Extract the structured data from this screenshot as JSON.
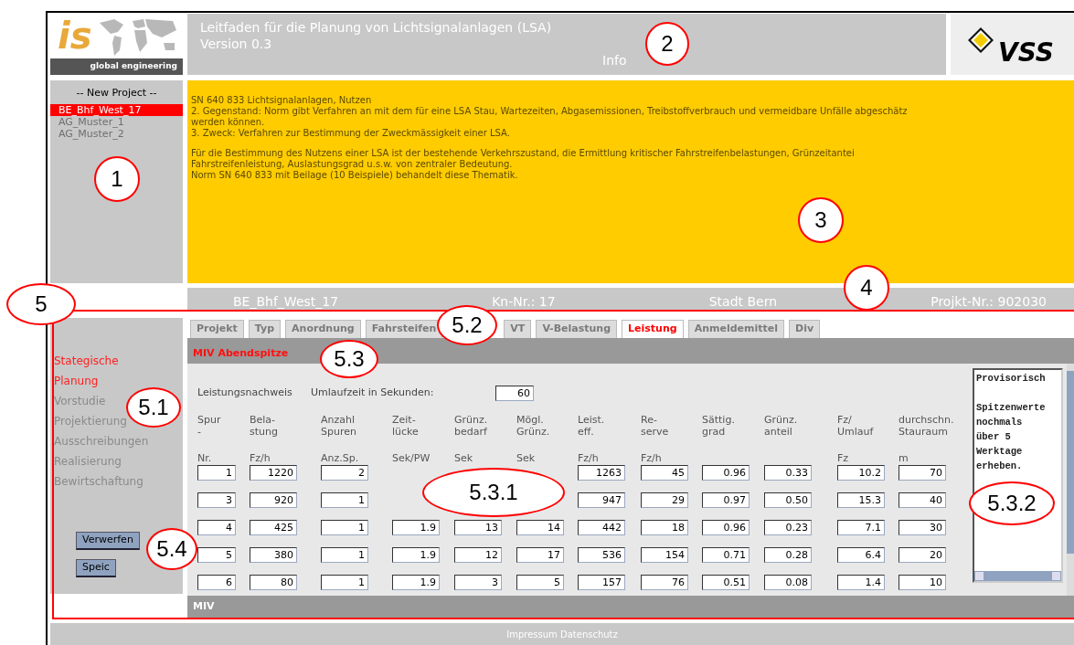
{
  "header": {
    "logo": {
      "mark": "is",
      "tagline": "global engineering"
    },
    "title": "Leitfaden für die Planung von Lichtsignalanlagen (LSA)",
    "version": "Version 0.3",
    "section": "Info",
    "partner_logo": "VSS"
  },
  "projects": {
    "heading": "-- New Project --",
    "items": [
      {
        "label": "BE_Bhf_West_17",
        "selected": true
      },
      {
        "label": "AG_Muster_1",
        "selected": false
      },
      {
        "label": "AG_Muster_2",
        "selected": false
      }
    ]
  },
  "info": {
    "paragraphs": [
      [
        "SN 640 833 Lichtsignalanlagen, Nutzen",
        "2. Gegenstand: Norm gibt Verfahren an mit dem für eine LSA Stau, Wartezeiten, Abgasemissionen, Treibstoffverbrauch und vermeidbare Unfälle abgeschätz",
        "werden können.",
        "3. Zweck: Verfahren zur Bestimmung der Zweckmässigkeit einer LSA."
      ],
      [
        "Für die Bestimmung des Nutzens einer LSA ist der bestehende Verkehrszustand, die Ermittlung kritischer Fahrstreifenbelastungen, Grünzeitantei",
        "Fahrstreifenleistung, Auslastungsgrad u.s.w. von zentraler Bedeutung.",
        "Norm SN 640 833 mit Beilage (10 Beispiele) behandelt diese Thematik."
      ]
    ]
  },
  "project_bar": [
    "BE_Bhf_West_17",
    "Kn-Nr.: 17",
    "Stadt Bern",
    "Projkt-Nr.: 902030"
  ],
  "phases": [
    {
      "label": "Stategische Planung",
      "selected": true
    },
    {
      "label": "Vorstudie",
      "selected": false
    },
    {
      "label": "Projektierung",
      "selected": false
    },
    {
      "label": "Ausschreibungen",
      "selected": false
    },
    {
      "label": "Realisierung",
      "selected": false
    },
    {
      "label": "Bewirtschaftung",
      "selected": false
    }
  ],
  "buttons": [
    "Verwerfen",
    "Speic"
  ],
  "tabs": [
    {
      "label": "Projekt",
      "selected": false
    },
    {
      "label": "Typ",
      "selected": false
    },
    {
      "label": "Anordnung",
      "selected": false
    },
    {
      "label": "Fahrsteifen",
      "selected": false
    },
    {
      "label": "VT",
      "selected": false
    },
    {
      "label": "V-Belastung",
      "selected": false
    },
    {
      "label": "Leistung",
      "selected": true
    },
    {
      "label": "Anmeldemittel",
      "selected": false
    },
    {
      "label": "Div",
      "selected": false
    }
  ],
  "panel": {
    "title": "MIV Abendspitze",
    "footer": "MIV",
    "heading": "Leistungsnachweis",
    "cycle_label": "Umlaufzeit in Sekunden:",
    "cycle_value": "60",
    "columns": [
      {
        "header": [
          "Spur",
          "-"
        ],
        "unit": "Nr."
      },
      {
        "header": [
          "Bela-",
          "stung"
        ],
        "unit": "Fz/h"
      },
      {
        "header": [
          "Anzahl",
          "Spuren"
        ],
        "unit": "Anz.Sp."
      },
      {
        "header": [
          "Zeit-",
          "lücke"
        ],
        "unit": "Sek/PW"
      },
      {
        "header": [
          "Grünz.",
          "bedarf"
        ],
        "unit": "Sek"
      },
      {
        "header": [
          "Mögl.",
          "Grünz."
        ],
        "unit": "Sek"
      },
      {
        "header": [
          "Leist.",
          "eff."
        ],
        "unit": "Fz/h"
      },
      {
        "header": [
          "Re-",
          "serve"
        ],
        "unit": "Fz/h"
      },
      {
        "header": [
          "Sättig.",
          "grad"
        ]
      },
      {
        "header": [
          "Grünz.",
          "anteil"
        ]
      },
      {
        "header": [
          "Fz/",
          "Umlauf"
        ],
        "unit": "Fz"
      },
      {
        "header": [
          "durchschn.",
          "Stauraum"
        ],
        "unit": "m"
      }
    ],
    "rows": [
      [
        "1",
        "1220",
        "2",
        null,
        null,
        null,
        "1263",
        "45",
        "0.96",
        "0.33",
        "10.2",
        "70"
      ],
      [
        "3",
        "920",
        "1",
        null,
        null,
        null,
        "947",
        "29",
        "0.97",
        "0.50",
        "15.3",
        "40"
      ],
      [
        "4",
        "425",
        "1",
        "1.9",
        "13",
        "14",
        "442",
        "18",
        "0.96",
        "0.23",
        "7.1",
        "30"
      ],
      [
        "5",
        "380",
        "1",
        "1.9",
        "12",
        "17",
        "536",
        "154",
        "0.71",
        "0.28",
        "6.4",
        "20"
      ],
      [
        "6",
        "80",
        "1",
        "1.9",
        "3",
        "5",
        "157",
        "76",
        "0.51",
        "0.08",
        "1.4",
        "10"
      ]
    ],
    "notes": [
      [
        "Provisorisch"
      ],
      [
        "Spitzenwerte",
        "nochmals",
        "über 5",
        "Werktage",
        "erheben."
      ]
    ]
  },
  "footer": "Impressum Datenschutz",
  "callouts": [
    "1",
    "2",
    "3",
    "4",
    "5",
    "5.1",
    "5.2",
    "5.3",
    "5.3.1",
    "5.3.2",
    "5.4"
  ]
}
